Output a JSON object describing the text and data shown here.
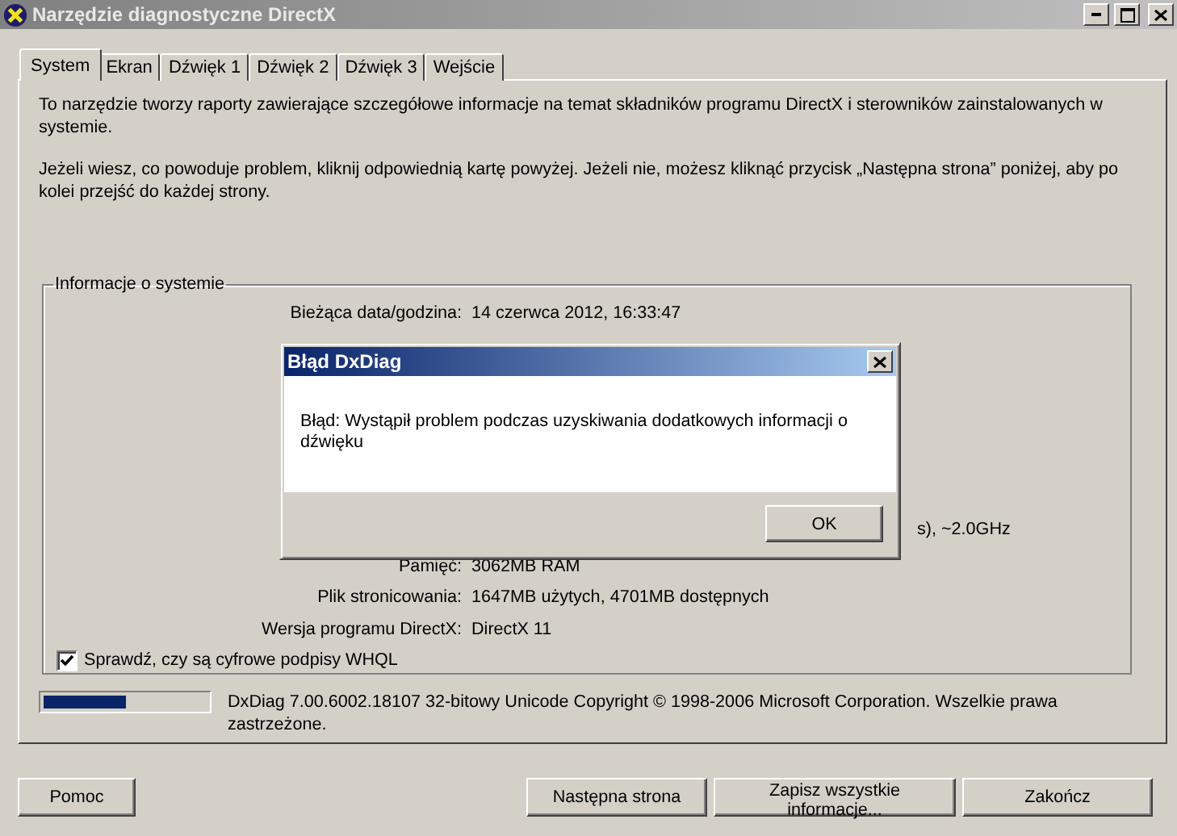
{
  "window": {
    "title": "Narzędzie diagnostyczne DirectX"
  },
  "tabs": [
    {
      "label": "System",
      "selected": true
    },
    {
      "label": "Ekran",
      "selected": false
    },
    {
      "label": "Dźwięk 1",
      "selected": false
    },
    {
      "label": "Dźwięk 2",
      "selected": false
    },
    {
      "label": "Dźwięk 3",
      "selected": false
    },
    {
      "label": "Wejście",
      "selected": false
    }
  ],
  "intro": [
    "To narzędzie tworzy raporty zawierające szczegółowe informacje na temat składników programu DirectX i sterowników zainstalowanych w systemie.",
    "Jeżeli wiesz, co powoduje problem, kliknij odpowiednią kartę powyżej. Jeżeli nie, możesz kliknąć przycisk „Następna strona” poniżej, aby po kolei przejść do każdej strony."
  ],
  "system_info": {
    "title": "Informacje o systemie",
    "rows": [
      {
        "label": "Bieżąca data/godzina:",
        "value": "14 czerwca 2012, 16:33:47"
      },
      {
        "value": "s), ~2.0GHz"
      },
      {
        "label": "Pamięć:",
        "value": "3062MB RAM"
      },
      {
        "label": "Plik stronicowania:",
        "value": "1647MB użytych, 4701MB dostępnych"
      },
      {
        "label": "Wersja programu DirectX:",
        "value": "DirectX 11"
      }
    ],
    "whql": {
      "label": "Sprawdź, czy są cyfrowe podpisy WHQL",
      "checked": true
    }
  },
  "progress": {
    "level": 0.5
  },
  "copyright": "DxDiag 7.00.6002.18107 32-bitowy Unicode  Copyright © 1998-2006 Microsoft Corporation. Wszelkie prawa zastrzeżone.",
  "buttons": [
    "Pomoc",
    "Następna strona",
    "Zapisz wszystkie informacje...",
    "Zakończ"
  ],
  "dialog": {
    "title": "Błąd DxDiag",
    "message": "Błąd: Wystąpił problem podczas uzyskiwania dodatkowych informacji o dźwięku",
    "button": "OK"
  }
}
